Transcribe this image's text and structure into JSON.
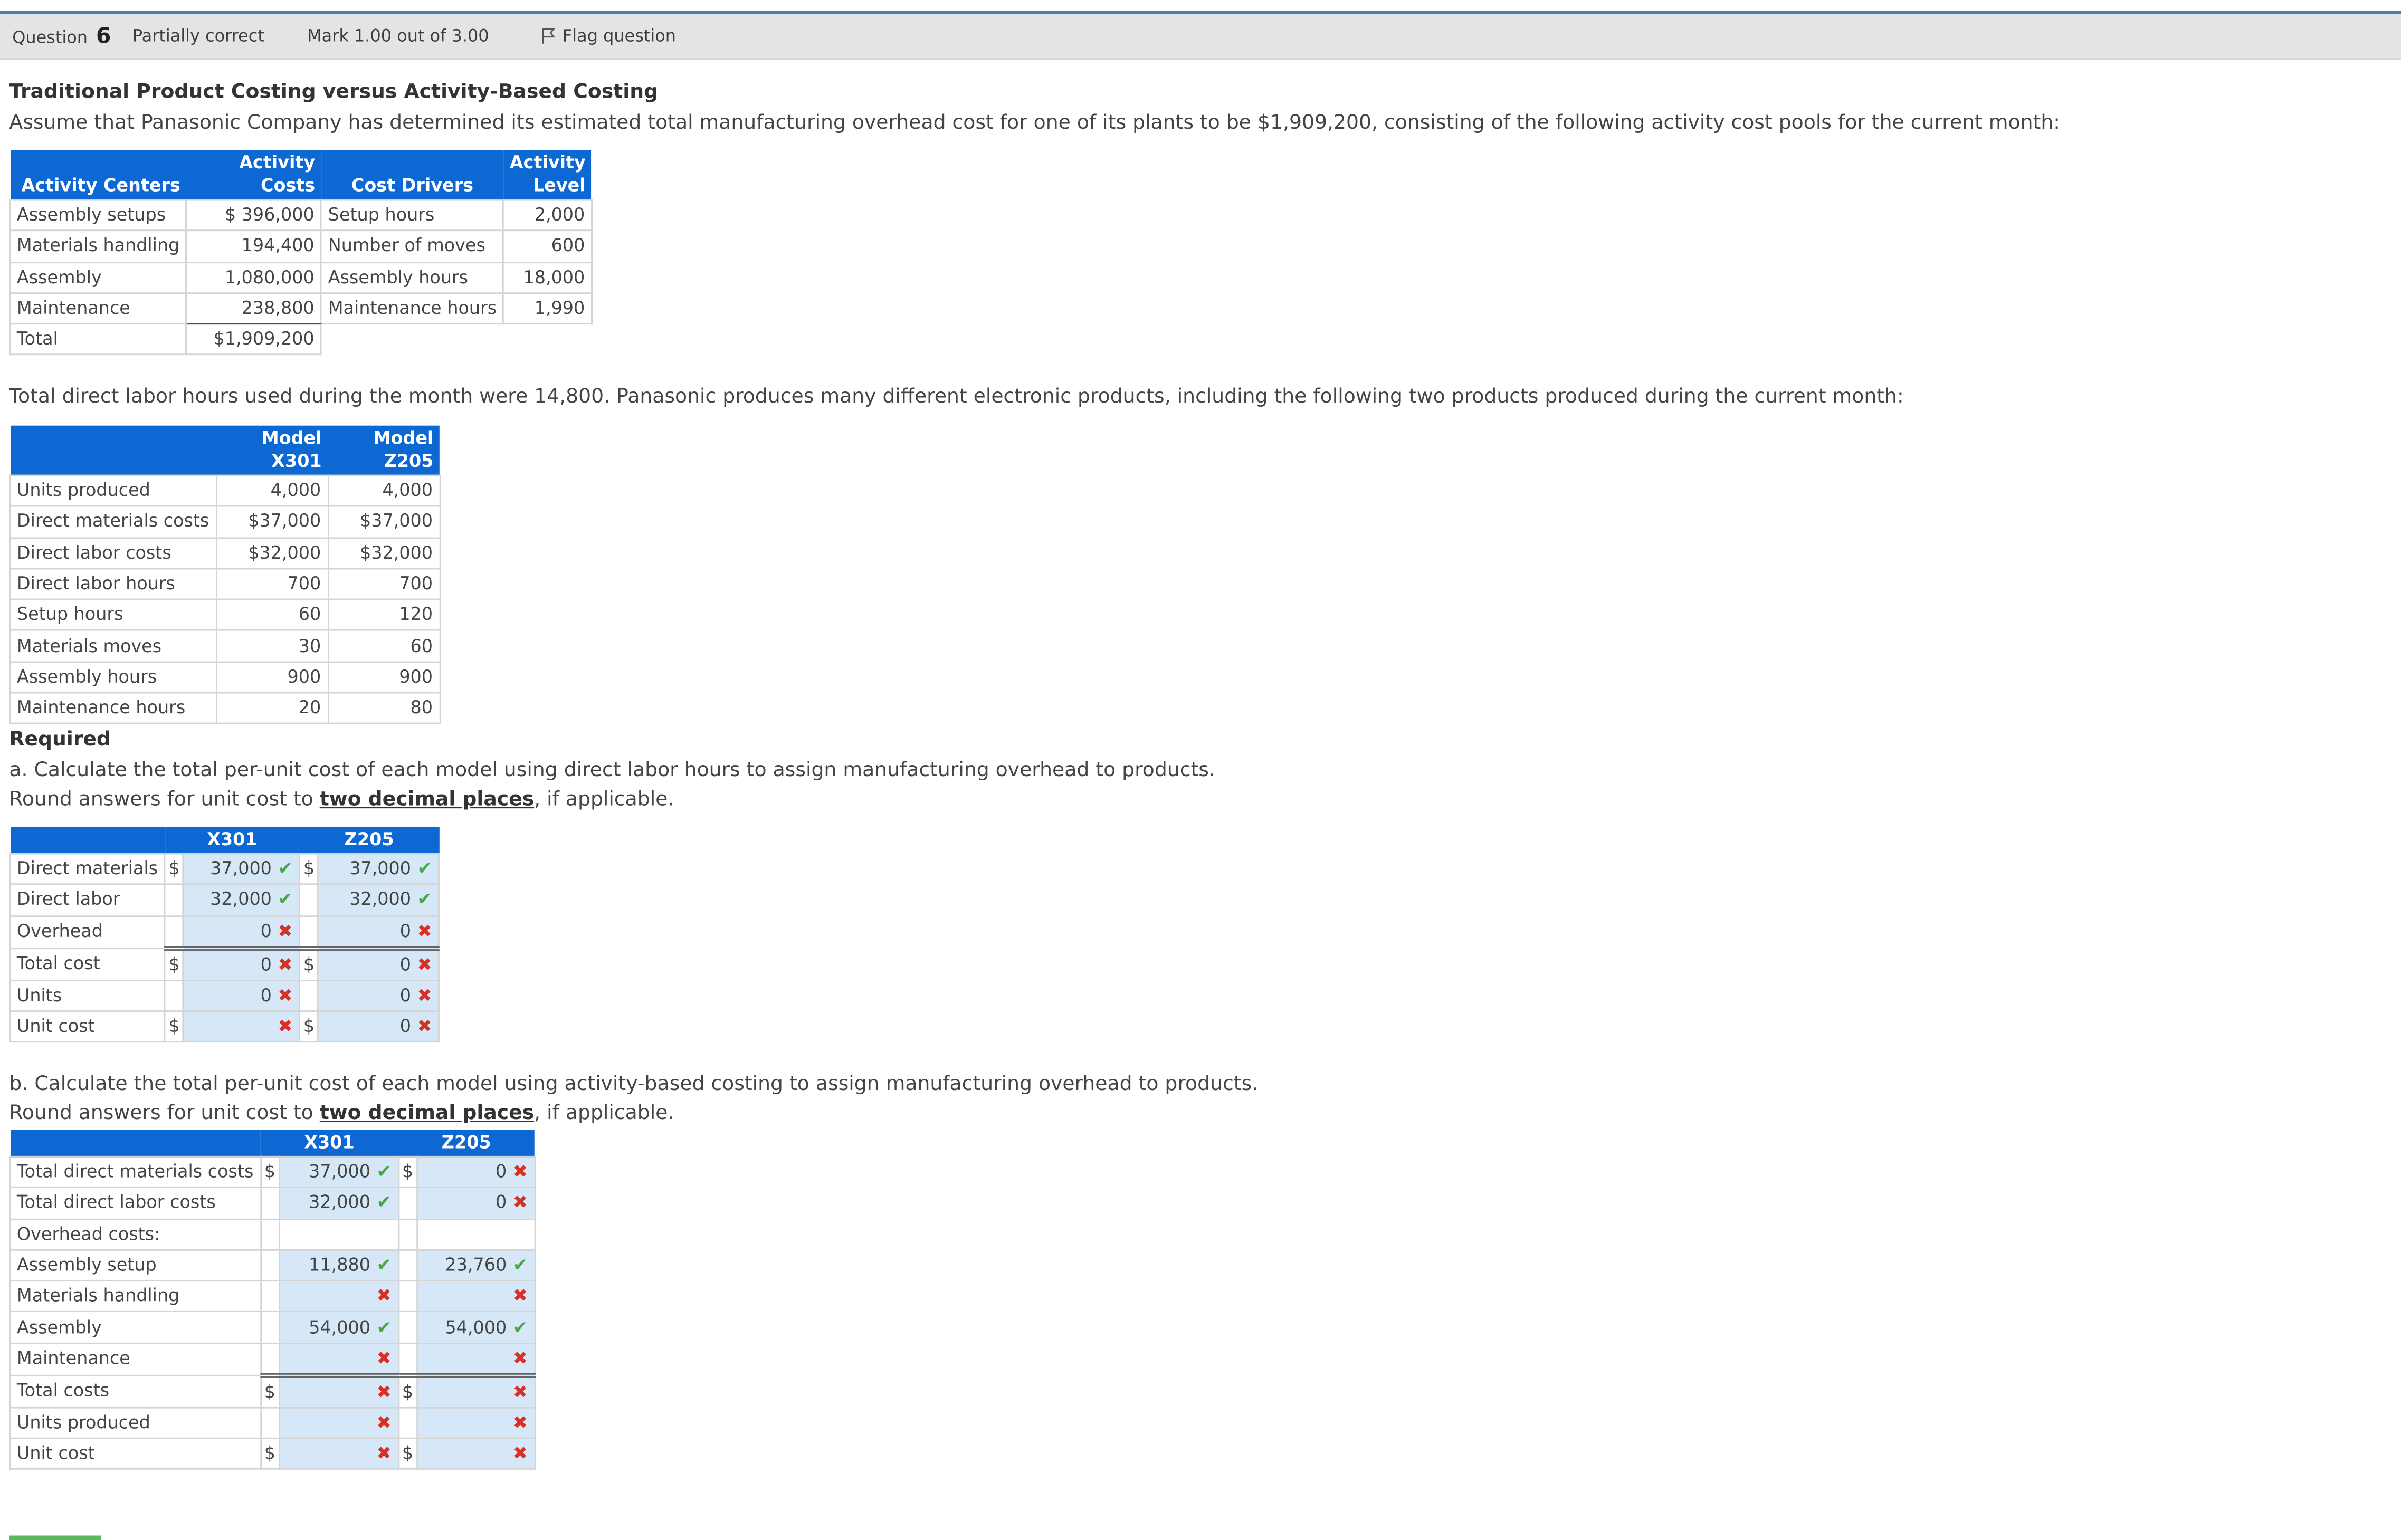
{
  "header": {
    "question_label": "Question",
    "question_number": "6",
    "state": "Partially correct",
    "mark": "Mark 1.00 out of 3.00",
    "flag_label": "Flag question"
  },
  "title": "Traditional Product Costing versus Activity-Based Costing",
  "intro": "Assume that Panasonic Company has determined its estimated total manufacturing overhead cost for one of its plants to be $1,909,200, consisting of the following activity cost pools for the current month:",
  "activity_table": {
    "headers": [
      "Activity Centers",
      "Activity Costs",
      "Cost Drivers",
      "Activity",
      "Level"
    ],
    "rows": [
      [
        "Assembly setups",
        "$ 396,000",
        "Setup hours",
        "2,000"
      ],
      [
        "Materials handling",
        "194,400",
        "Number of moves",
        "600"
      ],
      [
        "Assembly",
        "1,080,000",
        "Assembly hours",
        "18,000"
      ],
      [
        "Maintenance",
        "238,800",
        "Maintenance hours",
        "1,990"
      ]
    ],
    "total_label": "Total",
    "total_value": "$1,909,200"
  },
  "labor_text": "Total direct labor hours used during the month were 14,800. Panasonic produces many different electronic products, including the following two products produced during the current month:",
  "product_table": {
    "headers": [
      "Model X301",
      "Model Z205"
    ],
    "rows": [
      [
        "Units produced",
        "4,000",
        "4,000"
      ],
      [
        "Direct materials costs",
        "$37,000",
        "$37,000"
      ],
      [
        "Direct labor costs",
        "$32,000",
        "$32,000"
      ],
      [
        "Direct labor hours",
        "700",
        "700"
      ],
      [
        "Setup hours",
        "60",
        "120"
      ],
      [
        "Materials moves",
        "30",
        "60"
      ],
      [
        "Assembly hours",
        "900",
        "900"
      ],
      [
        "Maintenance hours",
        "20",
        "80"
      ]
    ]
  },
  "required": {
    "heading": "Required",
    "a_text": "a. Calculate the total per-unit cost of each model using direct labor hours to assign manufacturing overhead to products.",
    "round_prefix": "Round answers for unit cost to ",
    "round_link": "two decimal places",
    "round_suffix": ", if applicable.",
    "b_text": "b. Calculate the total per-unit cost of each model using activity-based costing to assign manufacturing overhead to products."
  },
  "table_a": {
    "headers": [
      "X301",
      "Z205"
    ],
    "rows": [
      {
        "label": "Direct materials",
        "sign1": "$",
        "v1": "37,000",
        "m1": "ok",
        "sign2": "$",
        "v2": "37,000",
        "m2": "ok"
      },
      {
        "label": "Direct labor",
        "sign1": "",
        "v1": "32,000",
        "m1": "ok",
        "sign2": "",
        "v2": "32,000",
        "m2": "ok"
      },
      {
        "label": "Overhead",
        "sign1": "",
        "v1": "0",
        "m1": "bad",
        "sign2": "",
        "v2": "0",
        "m2": "bad"
      },
      {
        "label": "Total cost",
        "sign1": "$",
        "v1": "0",
        "m1": "bad",
        "sign2": "$",
        "v2": "0",
        "m2": "bad"
      },
      {
        "label": "Units",
        "sign1": "",
        "v1": "0",
        "m1": "bad",
        "sign2": "",
        "v2": "0",
        "m2": "bad"
      },
      {
        "label": "Unit cost",
        "sign1": "$",
        "v1": "",
        "m1": "bad",
        "sign2": "$",
        "v2": "0",
        "m2": "bad"
      }
    ]
  },
  "table_b": {
    "headers": [
      "X301",
      "Z205"
    ],
    "rows": [
      {
        "label": "Total direct materials costs",
        "sign1": "$",
        "v1": "37,000",
        "m1": "ok",
        "sign2": "$",
        "v2": "0",
        "m2": "bad"
      },
      {
        "label": "Total direct labor costs",
        "sign1": "",
        "v1": "32,000",
        "m1": "ok",
        "sign2": "",
        "v2": "0",
        "m2": "bad"
      },
      {
        "label": "Overhead costs:",
        "sign1": "",
        "v1": "",
        "m1": "none",
        "sign2": "",
        "v2": "",
        "m2": "none"
      },
      {
        "label": "Assembly setup",
        "sign1": "",
        "v1": "11,880",
        "m1": "ok",
        "sign2": "",
        "v2": "23,760",
        "m2": "ok"
      },
      {
        "label": "Materials handling",
        "sign1": "",
        "v1": "",
        "m1": "bad",
        "sign2": "",
        "v2": "",
        "m2": "bad"
      },
      {
        "label": "Assembly",
        "sign1": "",
        "v1": "54,000",
        "m1": "ok",
        "sign2": "",
        "v2": "54,000",
        "m2": "ok"
      },
      {
        "label": "Maintenance",
        "sign1": "",
        "v1": "",
        "m1": "bad",
        "sign2": "",
        "v2": "",
        "m2": "bad"
      },
      {
        "label": "Total costs",
        "sign1": "$",
        "v1": "",
        "m1": "bad",
        "sign2": "$",
        "v2": "",
        "m2": "bad"
      },
      {
        "label": "Units produced",
        "sign1": "",
        "v1": "",
        "m1": "bad",
        "sign2": "",
        "v2": "",
        "m2": "bad"
      },
      {
        "label": "Unit cost",
        "sign1": "$",
        "v1": "",
        "m1": "bad",
        "sign2": "$",
        "v2": "",
        "m2": "bad"
      }
    ]
  },
  "marks": {
    "ok": "✔",
    "bad": "✖"
  },
  "colors": {
    "header_blue": "#0e68d4",
    "input_blue": "#d6e8f7",
    "correct": "#45a845",
    "incorrect": "#d93025"
  }
}
